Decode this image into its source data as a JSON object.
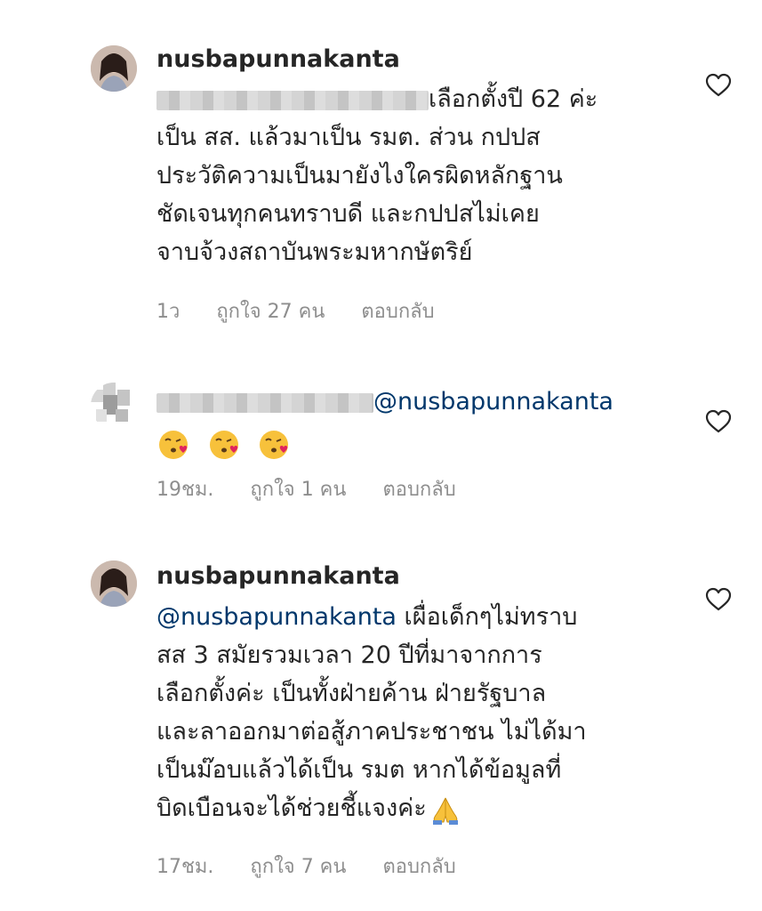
{
  "comments": [
    {
      "username": "nusbapunnakanta",
      "lines": [
        "เลือกตั้งปี 62 ค่ะ",
        "เป็น สส. แล้วมาเป็น รมต.  ส่วน กปปส",
        "ประวัติความเป็นมายังไงใครผิดหลักฐาน",
        "ชัดเจนทุกคนทราบดี และกปปสไม่เคย",
        "จาบจ้วงสถาบันพระมหากษัตริย์"
      ],
      "time": "1ว",
      "likes": "ถูกใจ 27 คน",
      "reply": "ตอบกลับ",
      "like_icon": "heart-outline-icon"
    },
    {
      "username": "",
      "mention": "@nusbapunnakanta",
      "emojis": [
        "kissing-heart-emoji",
        "kissing-heart-emoji",
        "kissing-heart-emoji"
      ],
      "time": "19ชม.",
      "likes": "ถูกใจ 1 คน",
      "reply": "ตอบกลับ",
      "like_icon": "heart-outline-icon"
    },
    {
      "username": "nusbapunnakanta",
      "mention": "@nusbapunnakanta",
      "first_line_rest": " เผื่อเด็กๆไม่ทราบ",
      "lines": [
        "สส 3 สมัยรวมเวลา 20 ปีที่มาจากการ",
        "เลือกตั้งค่ะ เป็นทั้งฝ่ายค้าน ฝ่ายรัฐบาล",
        "และลาออกมาต่อสู้ภาคประชาชน ไม่ได้มา",
        "เป็นม๊อบแล้วได้เป็น รมต หากได้ข้อมูลที่",
        "บิดเบือนจะได้ช่วยชี้แจงค่ะ"
      ],
      "trailing_emoji": "folded-hands-emoji",
      "time": "17ชม.",
      "likes": "ถูกใจ 7 คน",
      "reply": "ตอบกลับ",
      "like_icon": "heart-outline-icon"
    }
  ],
  "colors": {
    "text": "#262626",
    "meta": "#8e8e8e",
    "mention": "#00376b",
    "background": "#ffffff"
  }
}
